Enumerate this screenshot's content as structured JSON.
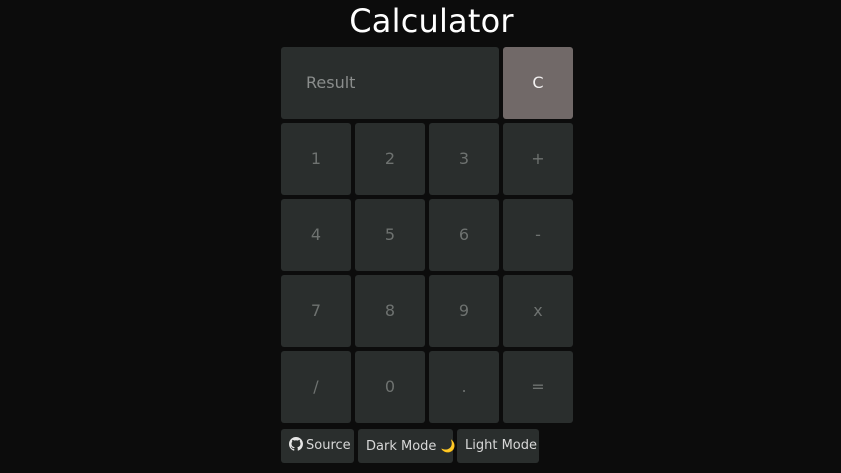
{
  "app": {
    "title": "Calculator"
  },
  "display": {
    "placeholder": "Result"
  },
  "clear": {
    "label": "C"
  },
  "keys": {
    "k1": "1",
    "k2": "2",
    "k3": "3",
    "plus": "+",
    "k4": "4",
    "k5": "5",
    "k6": "6",
    "minus": "-",
    "k7": "7",
    "k8": "8",
    "k9": "9",
    "times": "x",
    "divide": "/",
    "k0": "0",
    "dot": ".",
    "equals": "="
  },
  "footer": {
    "source_label": "Source",
    "source_icon": "github-icon",
    "dark_label": "Dark Mode",
    "dark_icon": "🌙",
    "light_label": "Light Mode"
  },
  "colors": {
    "background": "#0c0c0c",
    "key": "#2a2e2d",
    "clear": "#716968",
    "key_text": "#6e7270"
  }
}
